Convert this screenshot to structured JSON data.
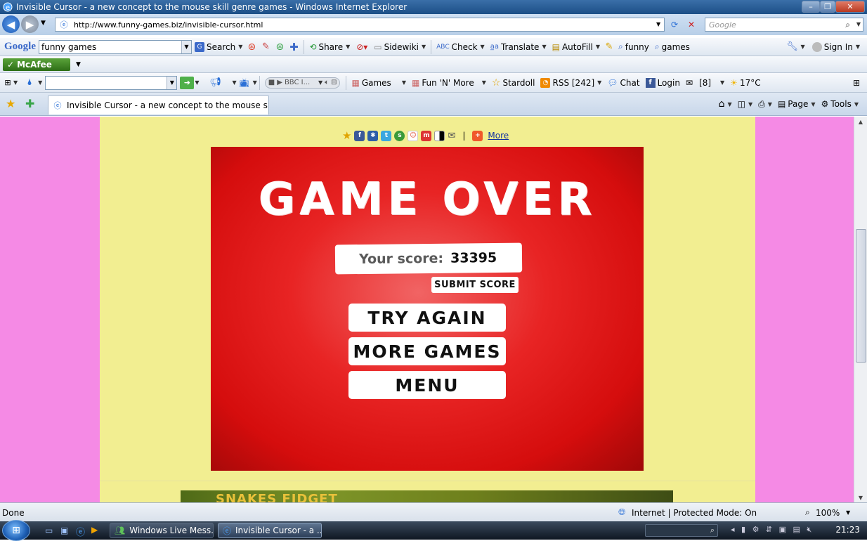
{
  "window": {
    "title": "Invisible Cursor - a new concept to the mouse skill genre games - Windows Internet Explorer"
  },
  "address": {
    "url": "http://www.funny-games.biz/invisible-cursor.html",
    "search_placeholder": "Google"
  },
  "google_toolbar": {
    "logo": "Google",
    "query": "funny games",
    "items": {
      "search": "Search",
      "share": "Share",
      "sidewiki": "Sidewiki",
      "check": "Check",
      "translate": "Translate",
      "autofill": "AutoFill",
      "funny": "funny",
      "games": "games",
      "signin": "Sign In"
    }
  },
  "mcafee": {
    "label": "McAfee"
  },
  "second_toolbar": {
    "radio_station": "BBC I...",
    "items": {
      "games": "Games",
      "fun_n_more": "Fun 'N' More",
      "stardoll": "Stardoll",
      "rss": "RSS [242]",
      "chat": "Chat",
      "login": "Login",
      "mail_count": "[8]",
      "weather": "17°C"
    }
  },
  "tabs": {
    "active": "Invisible Cursor - a new concept to the mouse ski...",
    "page": "Page",
    "tools": "Tools"
  },
  "share_bar": {
    "more": "More",
    "divider": "|"
  },
  "game": {
    "title": "GAME OVER",
    "score_label": "Your score:",
    "score": "33395",
    "submit": "SUBMIT SCORE",
    "try_again": "TRY AGAIN",
    "more_games": "MORE GAMES",
    "menu": "MENU"
  },
  "promo": {
    "text": "SNAKES FIDGET"
  },
  "status": {
    "left": "Done",
    "zone": "Internet | Protected Mode: On",
    "zoom": "100%"
  },
  "taskbar": {
    "task1": "Windows Live Mess...",
    "task2": "Invisible Cursor - a ...",
    "clock": "21:23"
  },
  "colors": {
    "page_bg": "#f58ae5",
    "content_bg": "#f2ee91",
    "game_red": "#e82424"
  }
}
